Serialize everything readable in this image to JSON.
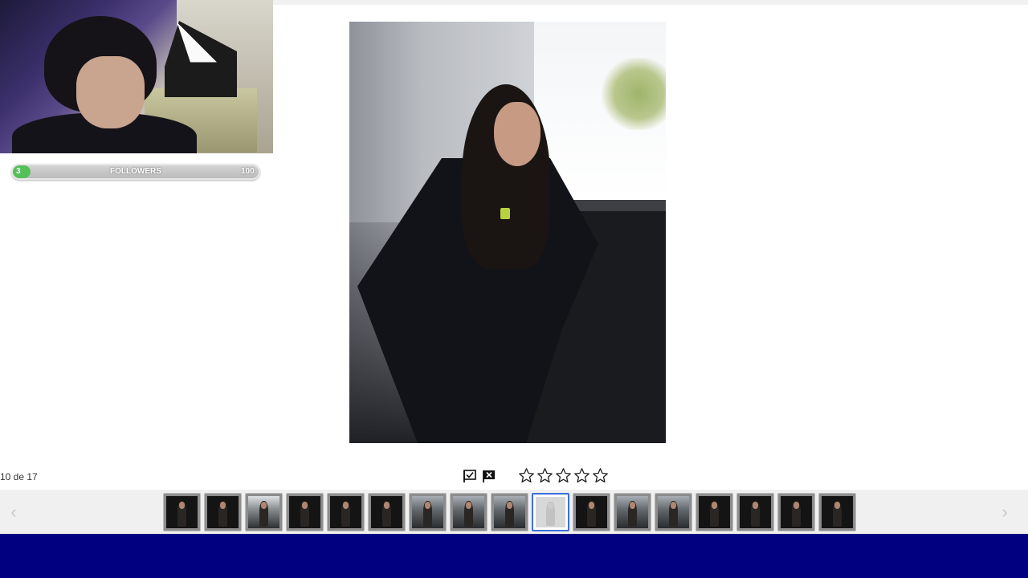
{
  "followers": {
    "label": "FOLLOWERS",
    "current": "3",
    "goal": "100",
    "progress_fraction": 0.03
  },
  "viewer": {
    "counter": "10 de 17",
    "rating_stars": 5,
    "current_index": 10,
    "total": 17
  },
  "icons": {
    "flag_check": "flag-check-icon",
    "flag_x": "flag-x-icon",
    "star": "star-outline-icon",
    "prev": "chevron-left-icon",
    "next": "chevron-right-icon"
  },
  "nav": {
    "prev_symbol": "‹",
    "next_symbol": "›"
  },
  "thumbnails": [
    {
      "style": "dark"
    },
    {
      "style": "dark"
    },
    {
      "style": "street"
    },
    {
      "style": "dark"
    },
    {
      "style": "dark"
    },
    {
      "style": "dark"
    },
    {
      "style": "light"
    },
    {
      "style": "light"
    },
    {
      "style": "light"
    },
    {
      "style": "active"
    },
    {
      "style": "dark"
    },
    {
      "style": "light"
    },
    {
      "style": "light"
    },
    {
      "style": "dark"
    },
    {
      "style": "dark"
    },
    {
      "style": "dark"
    },
    {
      "style": "dark"
    }
  ],
  "colors": {
    "followers_fill": "#55c05a",
    "active_thumb_border": "#3b6fd9",
    "bottom_bar": "#010080"
  }
}
